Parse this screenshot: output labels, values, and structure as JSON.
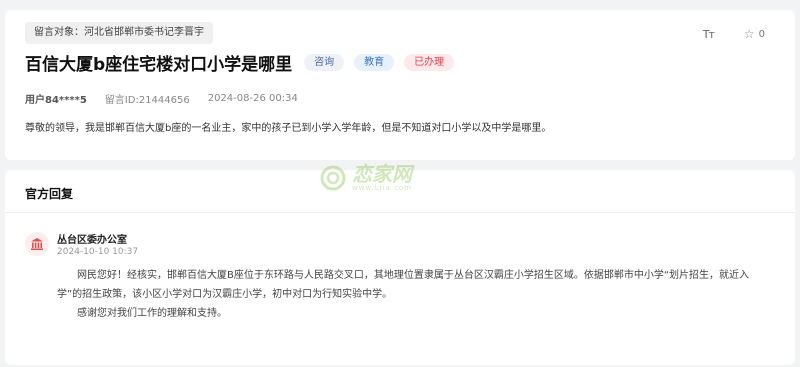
{
  "message": {
    "recipient": "留言对象：河北省邯郸市委书记李晋宇",
    "title": "百信大厦b座住宅楼对口小学是哪里",
    "tags": [
      "咨询",
      "教育",
      "已办理"
    ],
    "user": "用户84****5",
    "message_id": "留言ID:21444656",
    "date": "2024-08-26 00:34",
    "font_label": "Tт",
    "favorite_count": "0",
    "content": "尊敬的领导，我是邯郸百信大厦b座的一名业主，家中的孩子已到小学入学年龄，但是不知道对口小学以及中学是哪里。"
  },
  "reply": {
    "heading": "官方回复",
    "org": "丛台区委办公室",
    "time": "2024-10-10 10:37",
    "para1": "网民您好！经核实，邯郸百信大厦B座位于东环路与人民路交叉口，其地理位置隶属于丛台区汉霸庄小学招生区域。依据邯郸市中小学“划片招生，就近入学”的招生政策，该小区小学对口为汉霸庄小学，初中对口为行知实验中学。",
    "para2": "感谢您对我们工作的理解和支持。"
  },
  "watermark": {
    "text": "恋家网",
    "sub": "www.Ljia.com"
  },
  "colors": {
    "tag_consult": "#4a6c9a",
    "tag_edu": "#3d74b8",
    "tag_done": "#d64550",
    "org_icon": "#d9534f",
    "watermark": "#7bbf3a"
  },
  "icons": {
    "font_size": "font-size-icon",
    "favorite": "star-icon",
    "org": "government-building-icon"
  }
}
